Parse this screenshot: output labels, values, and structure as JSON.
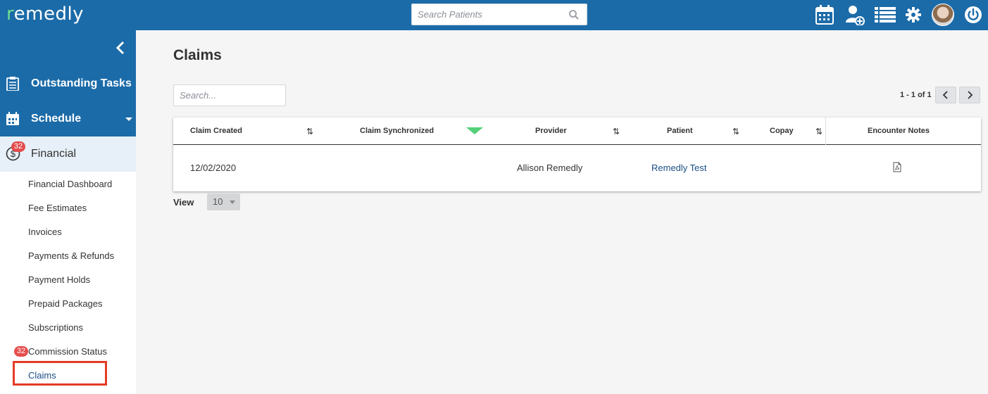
{
  "app": {
    "logo_prefix": "r",
    "logo_rest": "emedly",
    "search_placeholder": "Search Patients"
  },
  "header_icons": [
    "calendar-icon",
    "add-user-icon",
    "list-icon",
    "gear-icon",
    "avatar",
    "power-icon"
  ],
  "sidebar": {
    "primary": [
      {
        "label": "Outstanding Tasks",
        "icon": "clipboard-icon"
      },
      {
        "label": "Schedule",
        "icon": "calendar-icon"
      }
    ],
    "financial": {
      "label": "Financial",
      "icon": "dollar-icon",
      "badge": "32"
    },
    "sub_items": [
      {
        "label": "Financial Dashboard"
      },
      {
        "label": "Fee Estimates"
      },
      {
        "label": "Invoices"
      },
      {
        "label": "Payments & Refunds"
      },
      {
        "label": "Payment Holds"
      },
      {
        "label": "Prepaid Packages"
      },
      {
        "label": "Subscriptions"
      },
      {
        "label": "Commission Status",
        "badge": "32"
      },
      {
        "label": "Claims",
        "active": true
      }
    ]
  },
  "main": {
    "title": "Claims",
    "search_placeholder": "Search...",
    "pagination": "1 - 1 of 1",
    "columns": [
      "Claim Created",
      "Claim Synchronized",
      "Provider",
      "Patient",
      "Copay",
      "Encounter Notes"
    ],
    "rows": [
      {
        "claim_created": "12/02/2020",
        "claim_synchronized": "",
        "provider": "Allison Remedly",
        "patient": "Remedly Test",
        "copay": "",
        "encounter_notes_icon": "pdf-icon"
      }
    ],
    "view_label": "View",
    "view_value": "10"
  },
  "colors": {
    "brand_blue": "#1b6ba8",
    "logo_green": "#6ddc8e",
    "badge_red": "#e44d4d",
    "sort_active_green": "#55d07a",
    "link_blue": "#1b4f86",
    "highlight_red": "#e53b25"
  }
}
